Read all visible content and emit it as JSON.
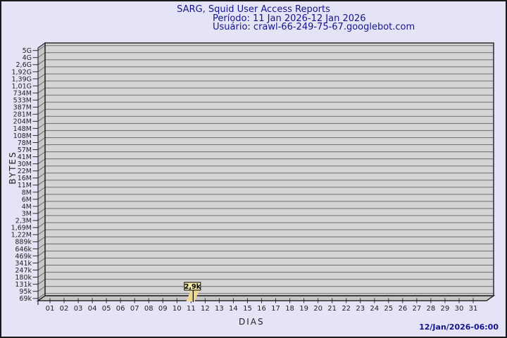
{
  "page": {
    "title": "SARG, Squid User Access Reports",
    "subtitle_period": "Período: 11 Jan 2026-12 Jan 2026",
    "subtitle_user": "Usuário: crawl-66-249-75-67.googlebot.com",
    "timestamp": "12/Jan/2026-06:00"
  },
  "colors": {
    "page_background": "#e4e4f6",
    "frame_border": "#1a1a1a",
    "title_text": "#14148c",
    "panel_fill": "#d4d4d4",
    "wall_fill": "#c7c7c7",
    "floor_fill": "#c7c7c7",
    "grid_line": "#6e6e6e",
    "axis_line": "#2a2a2a",
    "tick_text": "#222222",
    "flag_box_fill": "#f5eda6",
    "flag_ribbon_fill": "#f0d68e",
    "flag_border": "#000000"
  },
  "chart_data": {
    "type": "bar",
    "style": "3d-box",
    "title": "SARG, Squid User Access Reports",
    "subtitle": [
      "Período: 11 Jan 2026-12 Jan 2026",
      "Usuário: crawl-66-249-75-67.googlebot.com"
    ],
    "xlabel": "DIAS",
    "ylabel": "BYTES",
    "yscale": "log",
    "ylim": [
      "69k",
      "5G"
    ],
    "grid": true,
    "y_tick_labels_top_to_bottom": [
      "5G",
      "4G",
      "2,6G",
      "1,92G",
      "1,39G",
      "1,01G",
      "734M",
      "533M",
      "387M",
      "281M",
      "204M",
      "148M",
      "108M",
      "78M",
      "57M",
      "41M",
      "30M",
      "22M",
      "16M",
      "11M",
      "8M",
      "6M",
      "4M",
      "3M",
      "2,3M",
      "1,69M",
      "1,22M",
      "889k",
      "646k",
      "469k",
      "341k",
      "247k",
      "180k",
      "131k",
      "95k",
      "69k"
    ],
    "categories": [
      "01",
      "02",
      "03",
      "04",
      "05",
      "06",
      "07",
      "08",
      "09",
      "10",
      "11",
      "12",
      "13",
      "14",
      "15",
      "16",
      "17",
      "18",
      "19",
      "20",
      "21",
      "22",
      "23",
      "24",
      "25",
      "26",
      "27",
      "28",
      "29",
      "30",
      "31"
    ],
    "values_bytes": [
      0,
      0,
      0,
      0,
      0,
      0,
      0,
      0,
      0,
      0,
      2900,
      0,
      0,
      0,
      0,
      0,
      0,
      0,
      0,
      0,
      0,
      0,
      0,
      0,
      0,
      0,
      0,
      0,
      0,
      0,
      0
    ],
    "annotations": [
      {
        "category": "11",
        "label": "2,9k",
        "value_bytes": 2900
      }
    ],
    "generated_timestamp": "12/Jan/2026-06:00"
  }
}
